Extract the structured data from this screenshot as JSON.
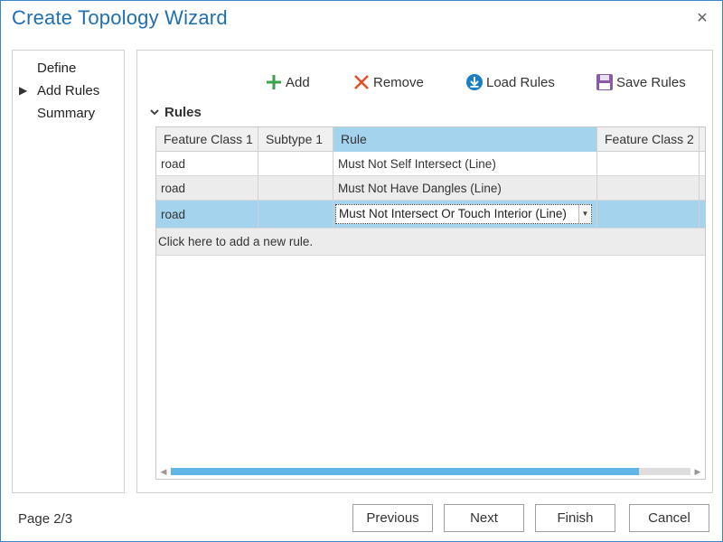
{
  "window": {
    "title": "Create Topology Wizard",
    "close_icon": "close-icon"
  },
  "nav": {
    "items": [
      {
        "label": "Define",
        "current": false
      },
      {
        "label": "Add Rules",
        "current": true
      },
      {
        "label": "Summary",
        "current": false
      }
    ],
    "current_marker": "▶"
  },
  "toolbar": {
    "add": {
      "label": "Add",
      "icon": "plus-icon",
      "color": "#3aa34a"
    },
    "remove": {
      "label": "Remove",
      "icon": "x-icon",
      "color": "#e0522a"
    },
    "load": {
      "label": "Load Rules",
      "icon": "download-circle-icon",
      "color": "#1a7ec6"
    },
    "save": {
      "label": "Save Rules",
      "icon": "floppy-disk-icon",
      "color": "#8a5aa8"
    }
  },
  "rules": {
    "section_title": "Rules",
    "columns": [
      "Feature Class 1",
      "Subtype 1",
      "Rule",
      "Feature Class 2"
    ],
    "rows": [
      {
        "fc1": "road",
        "subtype1": "",
        "rule": "Must Not Self Intersect (Line)",
        "fc2": ""
      },
      {
        "fc1": "road",
        "subtype1": "",
        "rule": "Must Not Have Dangles (Line)",
        "fc2": ""
      },
      {
        "fc1": "road",
        "subtype1": "",
        "rule": "Must Not Intersect Or Touch Interior (Line)",
        "fc2": ""
      }
    ],
    "add_new_text": "Click here to add a new rule.",
    "selection_color": "#a4d3ee"
  },
  "footer": {
    "page": "Page 2/3",
    "buttons": {
      "previous": "Previous",
      "next": "Next",
      "finish": "Finish",
      "cancel": "Cancel"
    }
  }
}
